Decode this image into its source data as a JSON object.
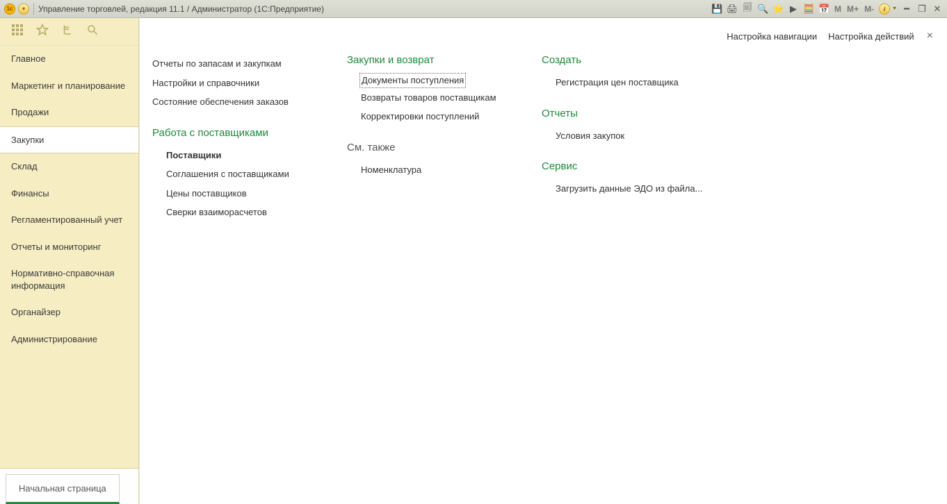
{
  "titlebar": {
    "title": "Управление торговлей, редакция 11.1 / Администратор  (1С:Предприятие)",
    "m": "M",
    "mp": "M+",
    "mm": "M-"
  },
  "sidebar": {
    "items": [
      {
        "label": "Главное"
      },
      {
        "label": "Маркетинг и планирование"
      },
      {
        "label": "Продажи"
      },
      {
        "label": "Закупки"
      },
      {
        "label": "Склад"
      },
      {
        "label": "Финансы"
      },
      {
        "label": "Регламентированный учет"
      },
      {
        "label": "Отчеты и мониторинг"
      },
      {
        "label": "Нормативно-справочная информация"
      },
      {
        "label": "Органайзер"
      },
      {
        "label": "Администрирование"
      }
    ],
    "active_index": 3,
    "start_tab": "Начальная страница"
  },
  "topbar": {
    "nav_settings": "Настройка навигации",
    "act_settings": "Настройка действий"
  },
  "columns": [
    {
      "groups": [
        {
          "title": null,
          "links": [
            {
              "label": "Отчеты по запасам и закупкам"
            },
            {
              "label": "Настройки и справочники"
            },
            {
              "label": "Состояние обеспечения заказов"
            }
          ]
        },
        {
          "title": "Работа с поставщиками",
          "links": [
            {
              "label": "Поставщики",
              "bold": true
            },
            {
              "label": "Соглашения с поставщиками"
            },
            {
              "label": "Цены поставщиков"
            },
            {
              "label": "Сверки взаиморасчетов"
            }
          ]
        }
      ]
    },
    {
      "groups": [
        {
          "title": "Закупки и возврат",
          "links": [
            {
              "label": "Документы поступления",
              "selected": true
            },
            {
              "label": "Возвраты товаров поставщикам"
            },
            {
              "label": "Корректировки поступлений"
            }
          ]
        },
        {
          "title": "См. также",
          "dim": true,
          "links": [
            {
              "label": "Номенклатура"
            }
          ]
        }
      ]
    },
    {
      "groups": [
        {
          "title": "Создать",
          "links": [
            {
              "label": "Регистрация цен поставщика"
            }
          ]
        },
        {
          "title": "Отчеты",
          "links": [
            {
              "label": "Условия закупок"
            }
          ]
        },
        {
          "title": "Сервис",
          "links": [
            {
              "label": "Загрузить данные ЭДО из файла..."
            }
          ]
        }
      ]
    }
  ]
}
